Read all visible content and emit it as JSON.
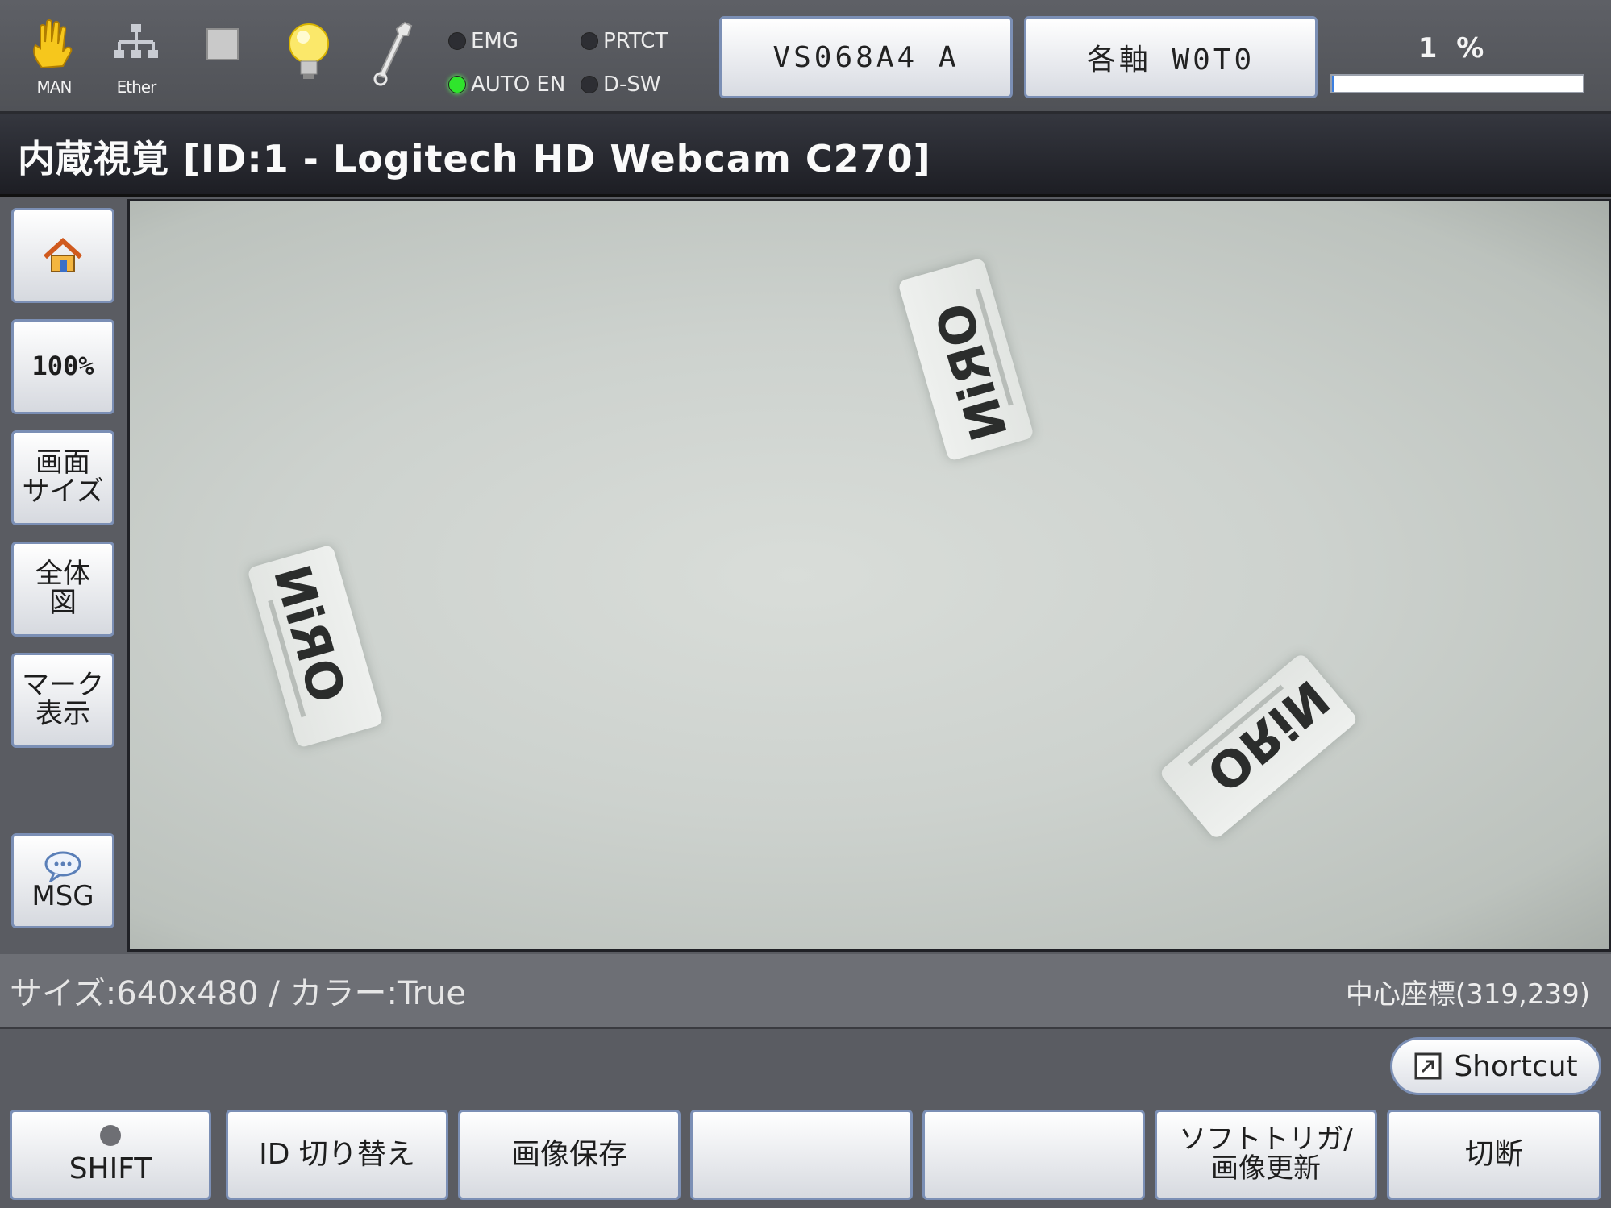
{
  "topbar": {
    "icons": [
      {
        "name": "hand-icon",
        "caption": "MAN"
      },
      {
        "name": "network-icon",
        "caption": "Ether"
      },
      {
        "name": "stop-square-icon",
        "caption": ""
      },
      {
        "name": "lightbulb-icon",
        "caption": ""
      },
      {
        "name": "wrench-icon",
        "caption": ""
      }
    ],
    "status": [
      {
        "label": "EMG",
        "on": false
      },
      {
        "label": "PRTCT",
        "on": false
      },
      {
        "label": "AUTO EN",
        "on": true
      },
      {
        "label": "D-SW",
        "on": false
      }
    ],
    "robot_button": "VS068A4 A",
    "axis_button": "各軸 W0T0",
    "speed_percent_label": "1 %",
    "speed_progress": 0.01
  },
  "title": "内蔵視覚 [ID:1 - Logitech HD Webcam C270]",
  "sidebar": {
    "items": [
      {
        "name": "home-button",
        "label": "",
        "icon": "home-icon"
      },
      {
        "name": "zoom-100-button",
        "label": "100%"
      },
      {
        "name": "screen-size-button",
        "label": "画面\nサイズ"
      },
      {
        "name": "overview-button",
        "label": "全体\n図"
      },
      {
        "name": "mark-display-button",
        "label": "マーク\n表示"
      },
      {
        "name": "msg-button",
        "label": "MSG",
        "icon": "chat-bubble-icon"
      }
    ]
  },
  "camera": {
    "objects": [
      {
        "text": "ORiN"
      },
      {
        "text": "ORiN"
      },
      {
        "text": "ORiN"
      }
    ]
  },
  "info": {
    "left": "サイズ:640x480 / カラー:True",
    "right": "中心座標(319,239)"
  },
  "shortcut": {
    "label": "Shortcut",
    "icon": "shortcut-arrow-icon"
  },
  "function_keys": [
    {
      "name": "shift-button",
      "label": "SHIFT",
      "indicator": true
    },
    {
      "name": "id-switch-button",
      "label": "ID 切り替え"
    },
    {
      "name": "save-image-button",
      "label": "画像保存"
    },
    {
      "name": "f4-button",
      "label": ""
    },
    {
      "name": "f5-button",
      "label": ""
    },
    {
      "name": "soft-trigger-button",
      "label": "ソフトトリガ/\n画像更新"
    },
    {
      "name": "disconnect-button",
      "label": "切断"
    }
  ],
  "colors": {
    "lamp_on": "#2fe52c",
    "progress": "#3b7fe0",
    "button_border": "#7b8fb5"
  }
}
